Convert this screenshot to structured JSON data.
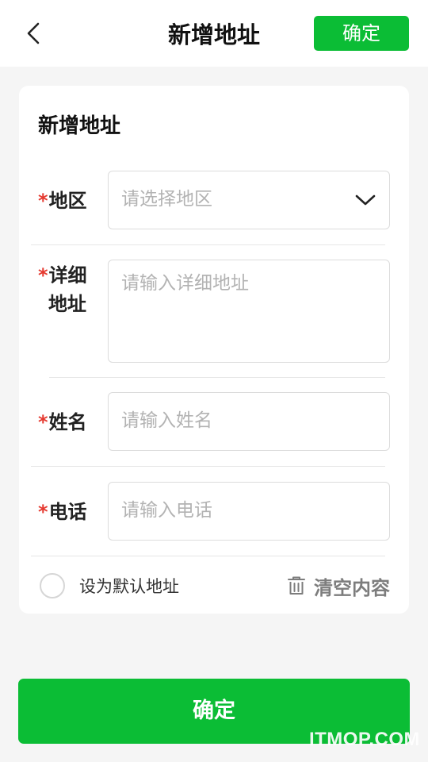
{
  "header": {
    "back_icon": "chevron-left-icon",
    "title": "新增地址",
    "confirm_label": "确定"
  },
  "card": {
    "title": "新增地址",
    "fields": {
      "region": {
        "required_mark": "*",
        "label": "地区",
        "placeholder": "请选择地区",
        "value": "",
        "icon": "chevron-down-icon"
      },
      "detail": {
        "required_mark": "*",
        "label_line1": "详细",
        "label_line2": "地址",
        "placeholder": "请输入详细地址",
        "value": ""
      },
      "name": {
        "required_mark": "*",
        "label": "姓名",
        "placeholder": "请输入姓名",
        "value": ""
      },
      "phone": {
        "required_mark": "*",
        "label": "电话",
        "placeholder": "请输入电话",
        "value": ""
      }
    },
    "default_address": {
      "label": "设为默认地址",
      "checked": false
    },
    "clear": {
      "icon": "trash-icon",
      "label": "清空内容"
    }
  },
  "footer": {
    "confirm_label": "确定"
  },
  "watermark": "ITMOP.COM",
  "colors": {
    "accent": "#0bbd35",
    "required": "#e5392f",
    "background": "#f5f5f5",
    "placeholder": "#b3b3b3"
  }
}
